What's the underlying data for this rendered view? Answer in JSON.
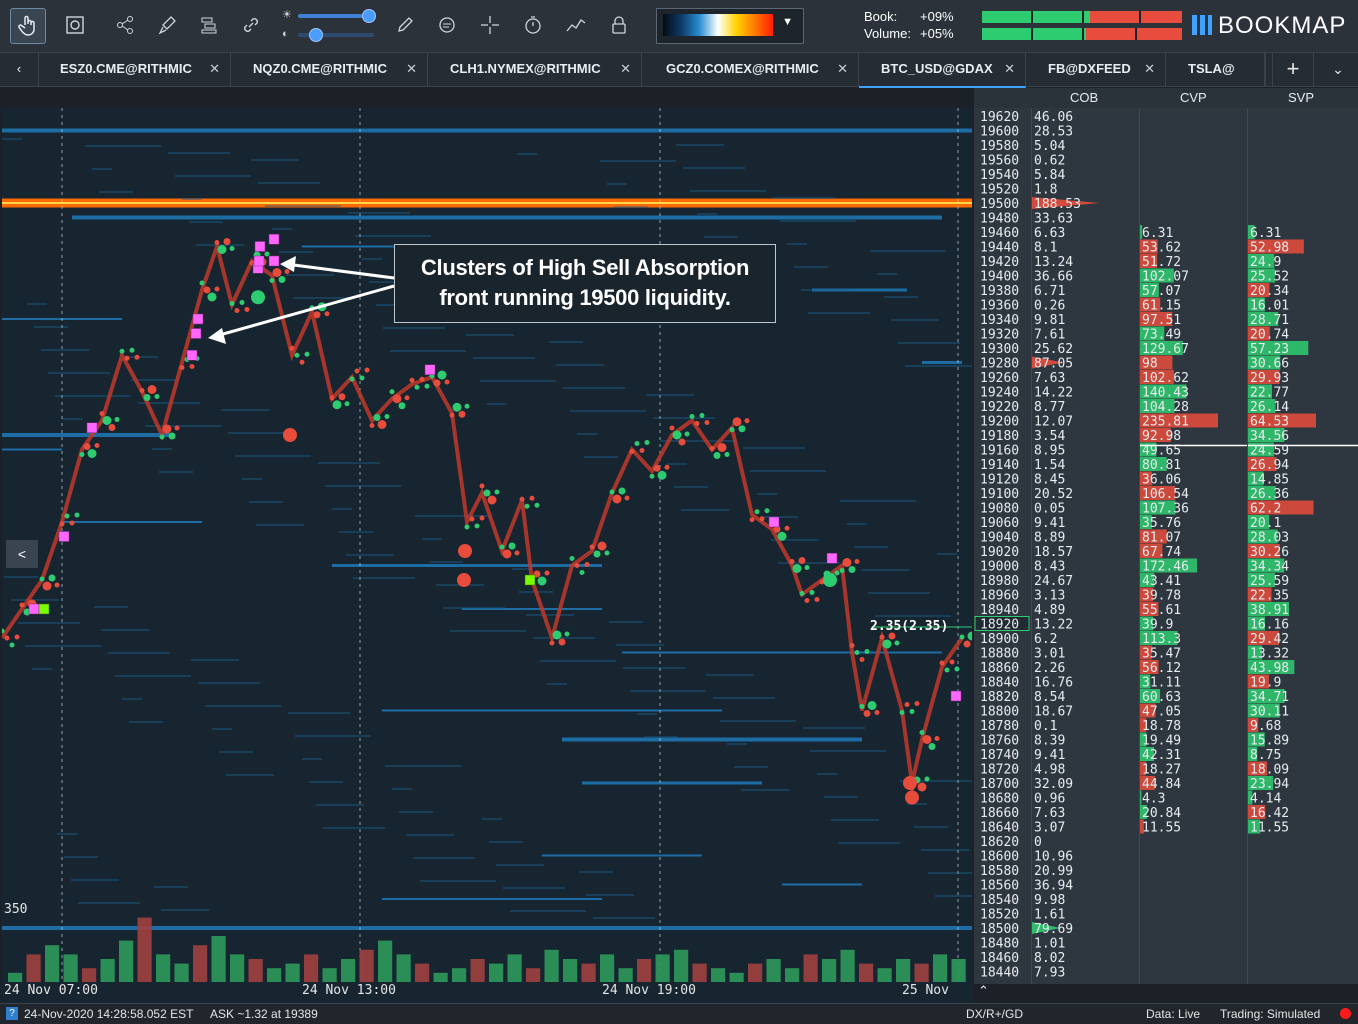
{
  "toolbar": {
    "tools": [
      "hand-pointer-icon",
      "zoom-box-icon",
      "share-icon",
      "brush-icon",
      "layers-icon",
      "link-icon"
    ],
    "tools2": [
      "pencil-icon",
      "chat-bubble-icon",
      "crosshair-icon",
      "stopwatch-icon",
      "line-tool-icon",
      "lock-icon"
    ],
    "book_label": "Book:",
    "book_value": "+09%",
    "volume_label": "Volume:",
    "volume_value": "+05%",
    "book_buy_fraction": 0.54,
    "volume_buy_fraction": 0.52,
    "logo": "BOOKMAP"
  },
  "tabs": [
    {
      "label": "ESZ0.CME@RITHMIC"
    },
    {
      "label": "NQZ0.CME@RITHMIC"
    },
    {
      "label": "CLH1.NYMEX@RITHMIC"
    },
    {
      "label": "GCZ0.COMEX@RITHMIC"
    },
    {
      "label": "BTC_USD@GDAX",
      "active": true
    },
    {
      "label": "FB@DXFEED"
    },
    {
      "label": "TSLA@"
    }
  ],
  "panel": {
    "headers": {
      "cob": "COB",
      "cvp": "CVP",
      "svp": "SVP"
    },
    "current_price": "18914",
    "last_trade_label": "2.35(2.35)",
    "cob_current": "13.22",
    "rows": [
      {
        "price": "19620",
        "cob": "46.06"
      },
      {
        "price": "19600",
        "cob": "28.53"
      },
      {
        "price": "19580",
        "cob": "5.04"
      },
      {
        "price": "19560",
        "cob": "0.62"
      },
      {
        "price": "19540",
        "cob": "5.84"
      },
      {
        "price": "19520",
        "cob": "1.8"
      },
      {
        "price": "19500",
        "cob": "188.53"
      },
      {
        "price": "19480",
        "cob": "33.63"
      },
      {
        "price": "19460",
        "cob": "6.63",
        "cvp": "6.31",
        "svp": "6.31"
      },
      {
        "price": "19440",
        "cob": "8.1",
        "cvp": "53.62",
        "svp": "52.98"
      },
      {
        "price": "19420",
        "cob": "13.24",
        "cvp": "51.72",
        "svp": "24.9"
      },
      {
        "price": "19400",
        "cob": "36.66",
        "cvp": "102.07",
        "svp": "25.52"
      },
      {
        "price": "19380",
        "cob": "6.71",
        "cvp": "57.07",
        "svp": "20.34"
      },
      {
        "price": "19360",
        "cob": "0.26",
        "cvp": "61.15",
        "svp": "16.01"
      },
      {
        "price": "19340",
        "cob": "9.81",
        "cvp": "97.51",
        "svp": "28.71"
      },
      {
        "price": "19320",
        "cob": "7.61",
        "cvp": "73.49",
        "svp": "20.74"
      },
      {
        "price": "19300",
        "cob": "25.62",
        "cvp": "129.67",
        "svp": "57.23"
      },
      {
        "price": "19280",
        "cob": "87.05",
        "cvp": "98",
        "svp": "30.66"
      },
      {
        "price": "19260",
        "cob": "7.63",
        "cvp": "102.62",
        "svp": "29.93"
      },
      {
        "price": "19240",
        "cob": "14.22",
        "cvp": "140.43",
        "svp": "22.77"
      },
      {
        "price": "19220",
        "cob": "8.77",
        "cvp": "104.28",
        "svp": "26.14"
      },
      {
        "price": "19200",
        "cob": "12.07",
        "cvp": "235.81",
        "svp": "64.53"
      },
      {
        "price": "19180",
        "cob": "3.54",
        "cvp": "92.98",
        "svp": "34.56"
      },
      {
        "price": "19160",
        "cob": "8.95",
        "cvp": "49.65",
        "svp": "24.59"
      },
      {
        "price": "19140",
        "cob": "1.54",
        "cvp": "80.81",
        "svp": "26.94"
      },
      {
        "price": "19120",
        "cob": "8.45",
        "cvp": "36.06",
        "svp": "14.85"
      },
      {
        "price": "19100",
        "cob": "20.52",
        "cvp": "106.54",
        "svp": "26.36"
      },
      {
        "price": "19080",
        "cob": "0.05",
        "cvp": "107.36",
        "svp": "62.2"
      },
      {
        "price": "19060",
        "cob": "9.41",
        "cvp": "35.76",
        "svp": "20.1"
      },
      {
        "price": "19040",
        "cob": "8.89",
        "cvp": "81.07",
        "svp": "28.03"
      },
      {
        "price": "19020",
        "cob": "18.57",
        "cvp": "67.74",
        "svp": "30.26"
      },
      {
        "price": "19000",
        "cob": "8.43",
        "cvp": "172.46",
        "svp": "34.34"
      },
      {
        "price": "18980",
        "cob": "24.67",
        "cvp": "43.41",
        "svp": "25.59"
      },
      {
        "price": "18960",
        "cob": "3.13",
        "cvp": "39.78",
        "svp": "22.35"
      },
      {
        "price": "18940",
        "cob": "4.89",
        "cvp": "55.61",
        "svp": "38.91"
      },
      {
        "price": "18920",
        "cob": "13.22",
        "cvp": "39.9",
        "svp": "16.16",
        "current": true
      },
      {
        "price": "18900",
        "cob": "6.2",
        "cvp": "113.3",
        "svp": "29.42"
      },
      {
        "price": "18880",
        "cob": "3.01",
        "cvp": "35.47",
        "svp": "13.32"
      },
      {
        "price": "18860",
        "cob": "2.26",
        "cvp": "56.12",
        "svp": "43.98"
      },
      {
        "price": "18840",
        "cob": "16.76",
        "cvp": "31.11",
        "svp": "19.9"
      },
      {
        "price": "18820",
        "cob": "8.54",
        "cvp": "60.63",
        "svp": "34.71"
      },
      {
        "price": "18800",
        "cob": "18.67",
        "cvp": "47.05",
        "svp": "30.11"
      },
      {
        "price": "18780",
        "cob": "0.1",
        "cvp": "18.78",
        "svp": "9.68"
      },
      {
        "price": "18760",
        "cob": "8.39",
        "cvp": "19.49",
        "svp": "15.89"
      },
      {
        "price": "18740",
        "cob": "9.41",
        "cvp": "42.31",
        "svp": "8.75"
      },
      {
        "price": "18720",
        "cob": "4.98",
        "cvp": "18.27",
        "svp": "18.09"
      },
      {
        "price": "18700",
        "cob": "32.09",
        "cvp": "44.84",
        "svp": "23.94"
      },
      {
        "price": "18680",
        "cob": "0.96",
        "cvp": "4.3",
        "svp": "4.14"
      },
      {
        "price": "18660",
        "cob": "7.63",
        "cvp": "20.84",
        "svp": "16.42"
      },
      {
        "price": "18640",
        "cob": "3.07",
        "cvp": "11.55",
        "svp": "11.55"
      },
      {
        "price": "18620",
        "cob": "0"
      },
      {
        "price": "18600",
        "cob": "10.96"
      },
      {
        "price": "18580",
        "cob": "20.99"
      },
      {
        "price": "18560",
        "cob": "36.94"
      },
      {
        "price": "18540",
        "cob": "9.98"
      },
      {
        "price": "18520",
        "cob": "1.61"
      },
      {
        "price": "18500",
        "cob": "79.69"
      },
      {
        "price": "18480",
        "cob": "1.01"
      },
      {
        "price": "18460",
        "cob": "8.02"
      },
      {
        "price": "18440",
        "cob": "7.93"
      }
    ]
  },
  "chart": {
    "callout": [
      "Clusters of High Sell Absorption",
      "front running 19500 liquidity."
    ],
    "volume_scale_label": "350",
    "time_labels": [
      "24 Nov 07:00",
      "24 Nov 13:00",
      "24 Nov 19:00",
      "25 Nov"
    ],
    "collapse_label": "<"
  },
  "status": {
    "timestamp": "24-Nov-2020 14:28:58.052 EST",
    "ask": "ASK ~1.32 at 19389",
    "feed": "DX/R+/GD",
    "data": "Data: Live",
    "trading": "Trading: Simulated"
  },
  "colors": {
    "buy": "#2ecc71",
    "sell": "#e74c3c",
    "absorption": "#ff66ff",
    "accent": "#3fa2ff"
  }
}
